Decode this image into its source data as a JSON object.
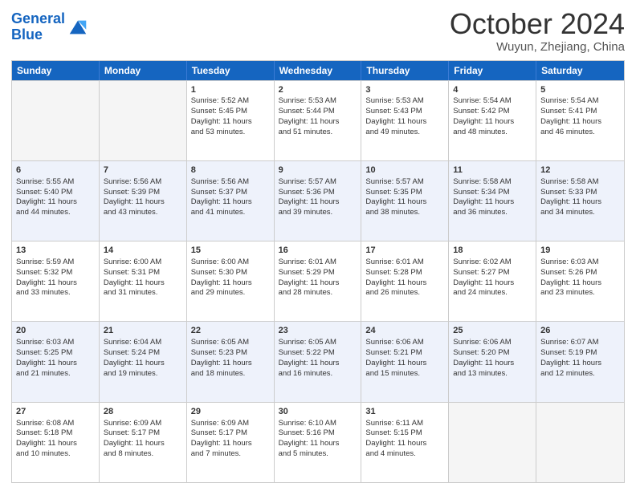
{
  "logo": {
    "line1": "General",
    "line2": "Blue"
  },
  "title": "October 2024",
  "subtitle": "Wuyun, Zhejiang, China",
  "header_days": [
    "Sunday",
    "Monday",
    "Tuesday",
    "Wednesday",
    "Thursday",
    "Friday",
    "Saturday"
  ],
  "rows": [
    [
      {
        "day": "",
        "lines": [],
        "empty": true
      },
      {
        "day": "",
        "lines": [],
        "empty": true
      },
      {
        "day": "1",
        "lines": [
          "Sunrise: 5:52 AM",
          "Sunset: 5:45 PM",
          "Daylight: 11 hours",
          "and 53 minutes."
        ]
      },
      {
        "day": "2",
        "lines": [
          "Sunrise: 5:53 AM",
          "Sunset: 5:44 PM",
          "Daylight: 11 hours",
          "and 51 minutes."
        ]
      },
      {
        "day": "3",
        "lines": [
          "Sunrise: 5:53 AM",
          "Sunset: 5:43 PM",
          "Daylight: 11 hours",
          "and 49 minutes."
        ]
      },
      {
        "day": "4",
        "lines": [
          "Sunrise: 5:54 AM",
          "Sunset: 5:42 PM",
          "Daylight: 11 hours",
          "and 48 minutes."
        ]
      },
      {
        "day": "5",
        "lines": [
          "Sunrise: 5:54 AM",
          "Sunset: 5:41 PM",
          "Daylight: 11 hours",
          "and 46 minutes."
        ]
      }
    ],
    [
      {
        "day": "6",
        "lines": [
          "Sunrise: 5:55 AM",
          "Sunset: 5:40 PM",
          "Daylight: 11 hours",
          "and 44 minutes."
        ]
      },
      {
        "day": "7",
        "lines": [
          "Sunrise: 5:56 AM",
          "Sunset: 5:39 PM",
          "Daylight: 11 hours",
          "and 43 minutes."
        ]
      },
      {
        "day": "8",
        "lines": [
          "Sunrise: 5:56 AM",
          "Sunset: 5:37 PM",
          "Daylight: 11 hours",
          "and 41 minutes."
        ]
      },
      {
        "day": "9",
        "lines": [
          "Sunrise: 5:57 AM",
          "Sunset: 5:36 PM",
          "Daylight: 11 hours",
          "and 39 minutes."
        ]
      },
      {
        "day": "10",
        "lines": [
          "Sunrise: 5:57 AM",
          "Sunset: 5:35 PM",
          "Daylight: 11 hours",
          "and 38 minutes."
        ]
      },
      {
        "day": "11",
        "lines": [
          "Sunrise: 5:58 AM",
          "Sunset: 5:34 PM",
          "Daylight: 11 hours",
          "and 36 minutes."
        ]
      },
      {
        "day": "12",
        "lines": [
          "Sunrise: 5:58 AM",
          "Sunset: 5:33 PM",
          "Daylight: 11 hours",
          "and 34 minutes."
        ]
      }
    ],
    [
      {
        "day": "13",
        "lines": [
          "Sunrise: 5:59 AM",
          "Sunset: 5:32 PM",
          "Daylight: 11 hours",
          "and 33 minutes."
        ]
      },
      {
        "day": "14",
        "lines": [
          "Sunrise: 6:00 AM",
          "Sunset: 5:31 PM",
          "Daylight: 11 hours",
          "and 31 minutes."
        ]
      },
      {
        "day": "15",
        "lines": [
          "Sunrise: 6:00 AM",
          "Sunset: 5:30 PM",
          "Daylight: 11 hours",
          "and 29 minutes."
        ]
      },
      {
        "day": "16",
        "lines": [
          "Sunrise: 6:01 AM",
          "Sunset: 5:29 PM",
          "Daylight: 11 hours",
          "and 28 minutes."
        ]
      },
      {
        "day": "17",
        "lines": [
          "Sunrise: 6:01 AM",
          "Sunset: 5:28 PM",
          "Daylight: 11 hours",
          "and 26 minutes."
        ]
      },
      {
        "day": "18",
        "lines": [
          "Sunrise: 6:02 AM",
          "Sunset: 5:27 PM",
          "Daylight: 11 hours",
          "and 24 minutes."
        ]
      },
      {
        "day": "19",
        "lines": [
          "Sunrise: 6:03 AM",
          "Sunset: 5:26 PM",
          "Daylight: 11 hours",
          "and 23 minutes."
        ]
      }
    ],
    [
      {
        "day": "20",
        "lines": [
          "Sunrise: 6:03 AM",
          "Sunset: 5:25 PM",
          "Daylight: 11 hours",
          "and 21 minutes."
        ]
      },
      {
        "day": "21",
        "lines": [
          "Sunrise: 6:04 AM",
          "Sunset: 5:24 PM",
          "Daylight: 11 hours",
          "and 19 minutes."
        ]
      },
      {
        "day": "22",
        "lines": [
          "Sunrise: 6:05 AM",
          "Sunset: 5:23 PM",
          "Daylight: 11 hours",
          "and 18 minutes."
        ]
      },
      {
        "day": "23",
        "lines": [
          "Sunrise: 6:05 AM",
          "Sunset: 5:22 PM",
          "Daylight: 11 hours",
          "and 16 minutes."
        ]
      },
      {
        "day": "24",
        "lines": [
          "Sunrise: 6:06 AM",
          "Sunset: 5:21 PM",
          "Daylight: 11 hours",
          "and 15 minutes."
        ]
      },
      {
        "day": "25",
        "lines": [
          "Sunrise: 6:06 AM",
          "Sunset: 5:20 PM",
          "Daylight: 11 hours",
          "and 13 minutes."
        ]
      },
      {
        "day": "26",
        "lines": [
          "Sunrise: 6:07 AM",
          "Sunset: 5:19 PM",
          "Daylight: 11 hours",
          "and 12 minutes."
        ]
      }
    ],
    [
      {
        "day": "27",
        "lines": [
          "Sunrise: 6:08 AM",
          "Sunset: 5:18 PM",
          "Daylight: 11 hours",
          "and 10 minutes."
        ]
      },
      {
        "day": "28",
        "lines": [
          "Sunrise: 6:09 AM",
          "Sunset: 5:17 PM",
          "Daylight: 11 hours",
          "and 8 minutes."
        ]
      },
      {
        "day": "29",
        "lines": [
          "Sunrise: 6:09 AM",
          "Sunset: 5:17 PM",
          "Daylight: 11 hours",
          "and 7 minutes."
        ]
      },
      {
        "day": "30",
        "lines": [
          "Sunrise: 6:10 AM",
          "Sunset: 5:16 PM",
          "Daylight: 11 hours",
          "and 5 minutes."
        ]
      },
      {
        "day": "31",
        "lines": [
          "Sunrise: 6:11 AM",
          "Sunset: 5:15 PM",
          "Daylight: 11 hours",
          "and 4 minutes."
        ]
      },
      {
        "day": "",
        "lines": [],
        "empty": true
      },
      {
        "day": "",
        "lines": [],
        "empty": true
      }
    ]
  ],
  "alt_rows": [
    1,
    3
  ]
}
